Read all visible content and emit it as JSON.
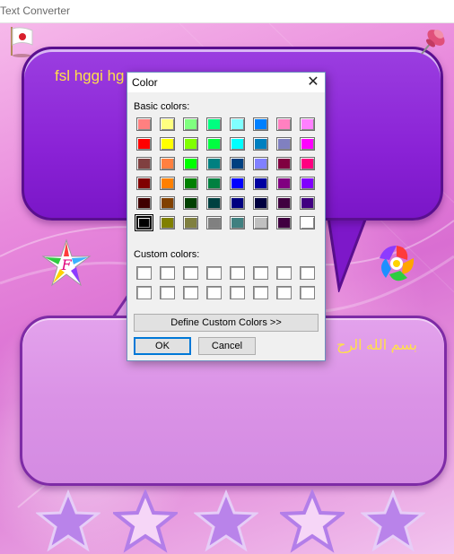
{
  "window": {
    "title": "Text Converter"
  },
  "bubbles": {
    "top_text": "fsl hggi hg",
    "bottom_text": "بسم الله الرح"
  },
  "icons": {
    "flag": "flag-icon",
    "pin": "pushpin-icon",
    "star_multi": "multicolor-star-icon",
    "flower": "rainbow-flower-icon",
    "bottom_stars": [
      "star-icon",
      "star-icon",
      "star-icon",
      "star-icon",
      "star-icon"
    ]
  },
  "dialog": {
    "title": "Color",
    "close_glyph": "✕",
    "basic_colors_label": "Basic colors:",
    "custom_colors_label": "Custom colors:",
    "define_custom_label": "Define Custom Colors >>",
    "ok_label": "OK",
    "cancel_label": "Cancel",
    "selected_basic_color": "#000000",
    "basic_colors": [
      [
        "#ff8080",
        "#ffff80",
        "#80ff80",
        "#00ff80",
        "#80ffff",
        "#0080ff",
        "#ff80c0",
        "#ff80ff"
      ],
      [
        "#ff0000",
        "#ffff00",
        "#80ff00",
        "#00ff40",
        "#00ffff",
        "#0080c0",
        "#8080c0",
        "#ff00ff"
      ],
      [
        "#804040",
        "#ff8040",
        "#00ff00",
        "#008080",
        "#004080",
        "#8080ff",
        "#800040",
        "#ff0080"
      ],
      [
        "#800000",
        "#ff8000",
        "#008000",
        "#008040",
        "#0000ff",
        "#0000a0",
        "#800080",
        "#8000ff"
      ],
      [
        "#400000",
        "#804000",
        "#004000",
        "#004040",
        "#000080",
        "#000040",
        "#400040",
        "#400080"
      ],
      [
        "#000000",
        "#808000",
        "#808040",
        "#808080",
        "#408080",
        "#c0c0c0",
        "#400040",
        "#ffffff"
      ]
    ],
    "custom_colors": [
      [
        "#ffffff",
        "#ffffff",
        "#ffffff",
        "#ffffff",
        "#ffffff",
        "#ffffff",
        "#ffffff",
        "#ffffff"
      ],
      [
        "#ffffff",
        "#ffffff",
        "#ffffff",
        "#ffffff",
        "#ffffff",
        "#ffffff",
        "#ffffff",
        "#ffffff"
      ]
    ]
  },
  "colors": {
    "bubble_purple": "#8a22d6",
    "bubble_pink": "#da92e6",
    "text_yellow": "#ffe04a",
    "background_pink": "#e889dc"
  }
}
